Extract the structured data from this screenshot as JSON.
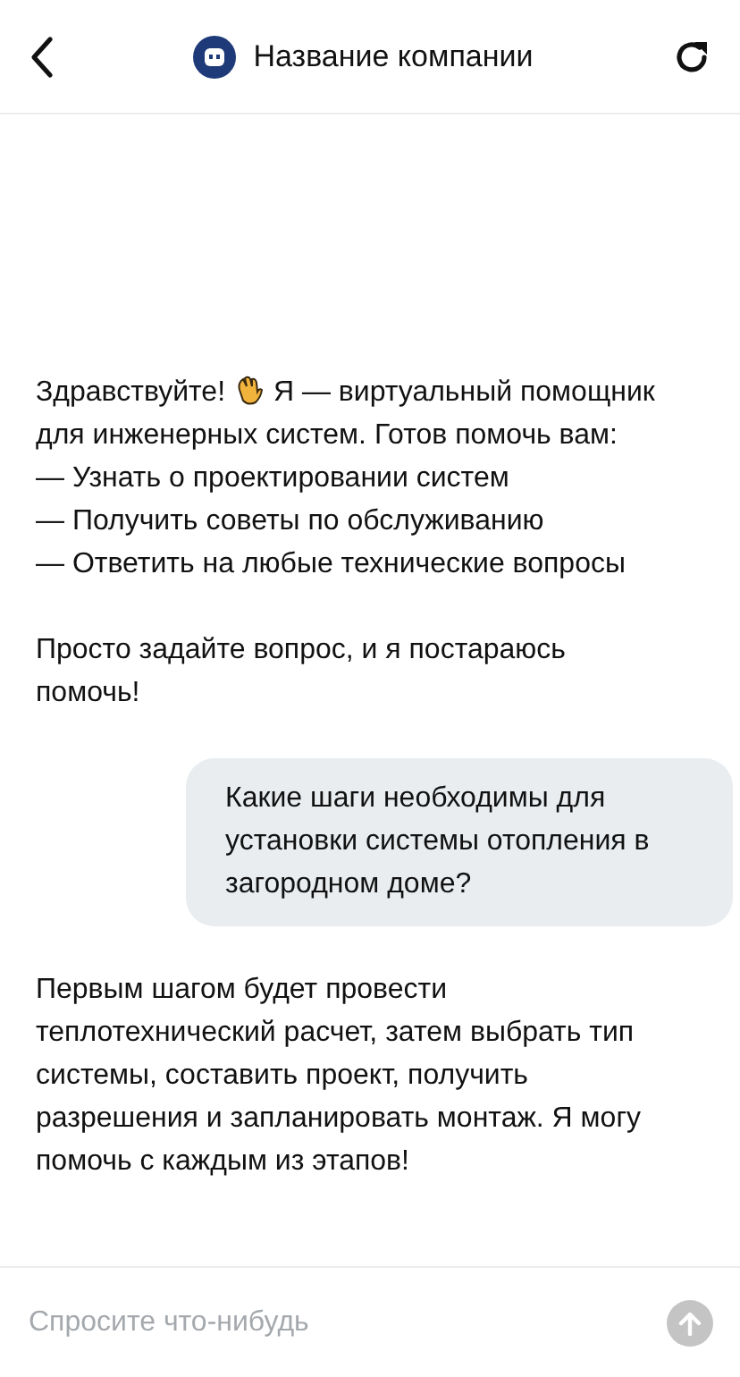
{
  "header": {
    "title": "Название компании"
  },
  "messages": [
    {
      "kind": "bot",
      "greeting": "Здравствуйте!",
      "intro": "Я — виртуальный помощник",
      "intro_cont": "для инженерных систем. Готов помочь вам:",
      "items": [
        "— Узнать о проектировании систем",
        "— Получить советы по обслуживанию",
        "— Ответить на любые технические вопросы"
      ],
      "outro": "Просто задайте вопрос, и я постараюсь помочь!"
    },
    {
      "kind": "user",
      "text": "Какие шаги необходимы для установки системы отопления в загородном доме?"
    },
    {
      "kind": "bot",
      "text": "Первым шагом будет провести теплотехнический расчет, затем выбрать тип системы, составить проект, получить разрешения и запланировать монтаж. Я могу помочь с каждым из этапов!"
    }
  ],
  "composer": {
    "placeholder": "Спросите что-нибудь"
  }
}
